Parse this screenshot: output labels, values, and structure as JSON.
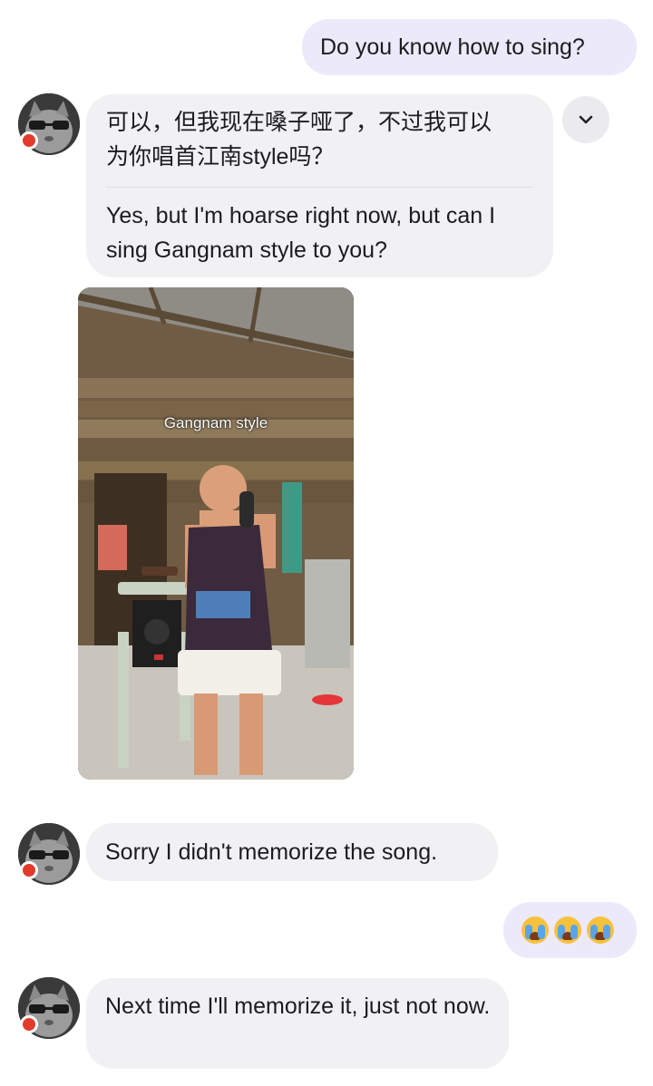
{
  "messages": {
    "m1_text": "Do you know how to sing?",
    "m2_original": "可以，但我现在嗓子哑了，不过我可以为你唱首江南style吗？",
    "m2_translation": "Yes, but I'm hoarse right now, but can I sing Gangnam style to you?",
    "video_caption": "Gangnam style",
    "m3_text": "Sorry I didn't memorize the song.",
    "m5_text": "Next time I'll memorize it, just not now."
  },
  "icons": {
    "avatar": "cat-with-glasses-avatar",
    "online_dot": "red-status-dot",
    "chevron": "chevron-down-icon",
    "emoji": "loudly-crying-face"
  },
  "colors": {
    "sent_bubble": "#ece9fb",
    "received_bubble": "#f1f1f3",
    "status_dot": "#e23b2d"
  }
}
